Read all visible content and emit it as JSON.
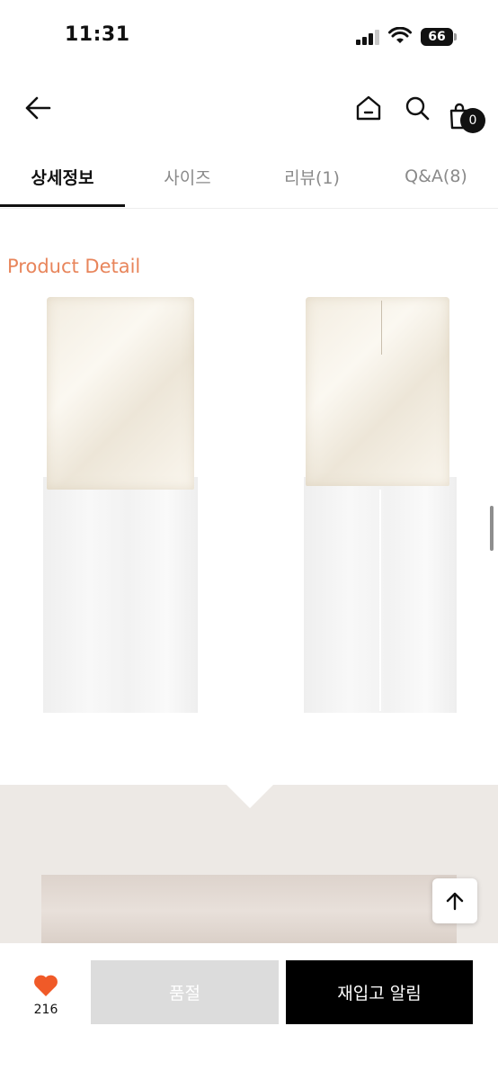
{
  "status_bar": {
    "time": "11:31",
    "battery": "66"
  },
  "header": {
    "cart_count": "0"
  },
  "tabs": [
    {
      "label": "상세정보",
      "active": true
    },
    {
      "label": "사이즈",
      "active": false
    },
    {
      "label": "리뷰(1)",
      "active": false
    },
    {
      "label": "Q&A(8)",
      "active": false
    }
  ],
  "content": {
    "section_title": "Product Detail"
  },
  "bottom_bar": {
    "like_count": "216",
    "soldout_label": "품절",
    "restock_label": "재입고 알림"
  },
  "colors": {
    "accent": "#e8855b",
    "like_heart": "#f05a28",
    "primary_button": "#000000",
    "disabled_button": "#dcdcdc"
  },
  "icons": [
    "back-arrow-icon",
    "home-icon",
    "search-icon",
    "cart-icon",
    "heart-icon",
    "arrow-up-icon",
    "signal-icon",
    "wifi-icon",
    "battery-icon"
  ]
}
